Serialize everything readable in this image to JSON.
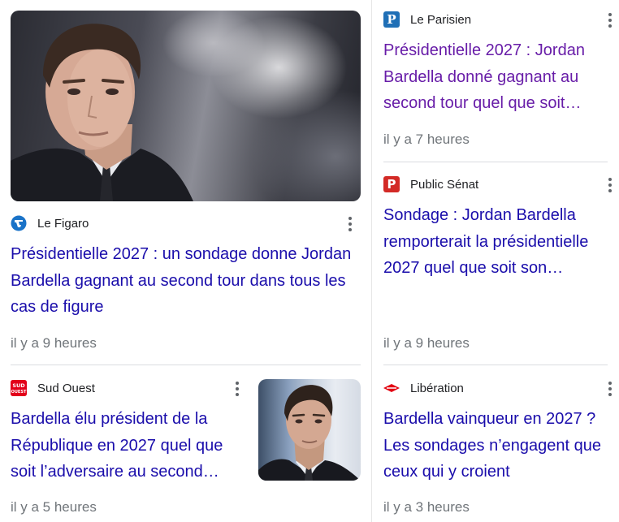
{
  "cards": [
    {
      "source": "Le Figaro",
      "logo_icon": "le-figaro-logo",
      "title": "Présidentielle 2027 : un sondage donne Jordan Bardella gagnant au second tour dans tous les cas de figure",
      "time": "il y a 9 heures",
      "has_image": true
    },
    {
      "source": "Sud Ouest",
      "logo_icon": "sud-ouest-logo",
      "logo_text": "SUD OUEST",
      "title": "Bardella élu président de la République en 2027 quel que soit l’adversaire au second…",
      "time": "il y a 5 heures",
      "has_image": true
    },
    {
      "source": "Le Parisien",
      "logo_icon": "le-parisien-logo",
      "logo_text": "P",
      "title": "Présidentielle 2027 : Jordan Bardella donné gagnant au second tour quel que soit…",
      "time": "il y a 7 heures",
      "visited": true
    },
    {
      "source": "Public Sénat",
      "logo_icon": "public-senat-logo",
      "logo_text": "P",
      "title": "Sondage : Jordan Bardella remporterait la présidentielle 2027 quel que soit son…",
      "time": "il y a 9 heures"
    },
    {
      "source": "Libération",
      "logo_icon": "liberation-logo",
      "title": "Bardella vainqueur en 2027 ? Les sondages n’engagent que ceux qui y croient",
      "time": "il y a 3 heures"
    }
  ],
  "colors": {
    "link": "#1a0dab",
    "visited_link": "#681da8",
    "meta_text": "#70757a",
    "le_parisien": "#1f6fb6",
    "public_senat": "#d32a26",
    "sud_ouest": "#e2001a",
    "liberation": "#e30613",
    "le_figaro": "#1a73c8"
  },
  "menu_icon": "more-vert-icon"
}
